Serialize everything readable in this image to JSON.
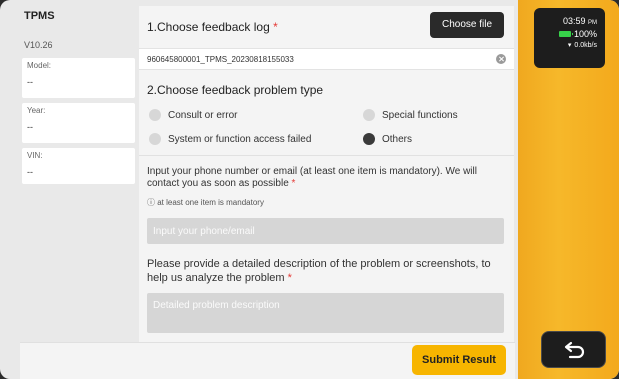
{
  "app": {
    "name": "TPMS",
    "version": "V10.26"
  },
  "vehicle_info": [
    {
      "label": "Model:",
      "value": "--"
    },
    {
      "label": "Year:",
      "value": "--"
    },
    {
      "label": "VIN:",
      "value": "--"
    }
  ],
  "feedback_log": {
    "title": "1.Choose feedback log",
    "required_mark": "*",
    "choose_file_label": "Choose file",
    "selected_file": "960645800001_TPMS_20230818155033"
  },
  "problem_type": {
    "title": "2.Choose feedback problem type",
    "options": [
      {
        "label": "Consult or error",
        "selected": false
      },
      {
        "label": "Special functions",
        "selected": false
      },
      {
        "label": "System or function access failed",
        "selected": false
      },
      {
        "label": "Others",
        "selected": true
      }
    ]
  },
  "contact": {
    "prompt": "Input your phone number or email (at least one item is mandatory). We will contact you as soon as possible",
    "required_mark": "*",
    "hint": "ⓘ at least one item is mandatory",
    "value": "",
    "placeholder": "Input your phone/email"
  },
  "description": {
    "prompt": "Please provide a detailed description of the problem or screenshots, to help us analyze the problem",
    "required_mark": "*",
    "value": "",
    "placeholder": "Detailed problem description"
  },
  "submit_label": "Submit Result",
  "status": {
    "time": "03:59",
    "time_suffix": "PM",
    "battery": "100%",
    "network_speed": "0.0kb/s"
  },
  "colors": {
    "accent": "#f7b500",
    "sidebar": "#f3a91c",
    "selected_radio": "#3a3a3a",
    "required": "#e53935"
  },
  "icons": {
    "clear": "clear-circle-icon",
    "battery": "battery-icon",
    "wifi": "wifi-icon",
    "back": "back-arrow-icon",
    "info": "info-icon"
  }
}
